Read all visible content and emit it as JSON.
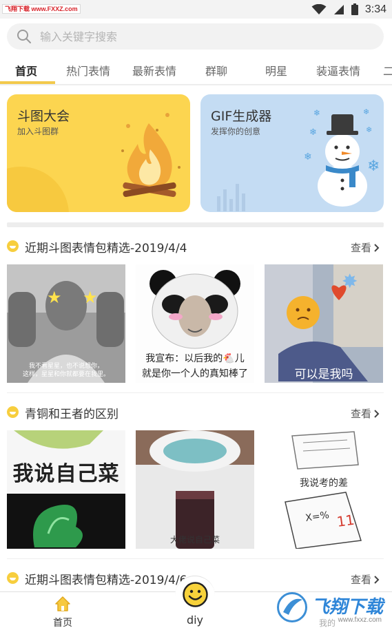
{
  "status": {
    "watermark": "飞翔下载 www.FXXZ.com",
    "time": "3:34"
  },
  "search": {
    "placeholder": "输入关键字搜索"
  },
  "tabs": [
    {
      "label": "首页"
    },
    {
      "label": "热门表情"
    },
    {
      "label": "最新表情"
    },
    {
      "label": "群聊"
    },
    {
      "label": "明星"
    },
    {
      "label": "装逼表情"
    },
    {
      "label": "二"
    }
  ],
  "banners": [
    {
      "title": "斗图大会",
      "subtitle": "加入斗图群",
      "color": "#fcd550"
    },
    {
      "title": "GIF生成器",
      "subtitle": "发挥你的创意",
      "color": "#c4dcf3"
    }
  ],
  "sections": [
    {
      "title": "近期斗图表情包精选-2019/4/4",
      "more": "查看",
      "items": [
        {
          "caption_line1": "我不看星星，也不说想你，",
          "caption_line2": "这样，星星和你就都要在我里。"
        },
        {
          "caption_line1": "我宣布：以后我的🐔儿",
          "caption_line2": "就是你一个人的真知棒了"
        },
        {
          "caption_line1": "可以是我吗",
          "caption_line2": ""
        }
      ]
    },
    {
      "title": "青铜和王者的区别",
      "more": "查看",
      "items": [
        {
          "caption_line1": "我说自己菜",
          "caption_line2": ""
        },
        {
          "caption_line1": "大佬说自己菜",
          "caption_line2": ""
        },
        {
          "caption_line1": "我说考的差",
          "caption_line2": ""
        }
      ]
    },
    {
      "title": "近期斗图表情包精选-2019/4/6",
      "more": "查看",
      "items": []
    }
  ],
  "bottom_nav": {
    "home": "首页",
    "diy": "diy",
    "mine": "我的"
  },
  "watermark_bottom": {
    "brand": "飞翔下载",
    "url": "www.fxxz.com"
  },
  "colors": {
    "accent": "#f2c94c",
    "banner_yellow": "#fcd550",
    "banner_blue": "#c4dcf3"
  }
}
